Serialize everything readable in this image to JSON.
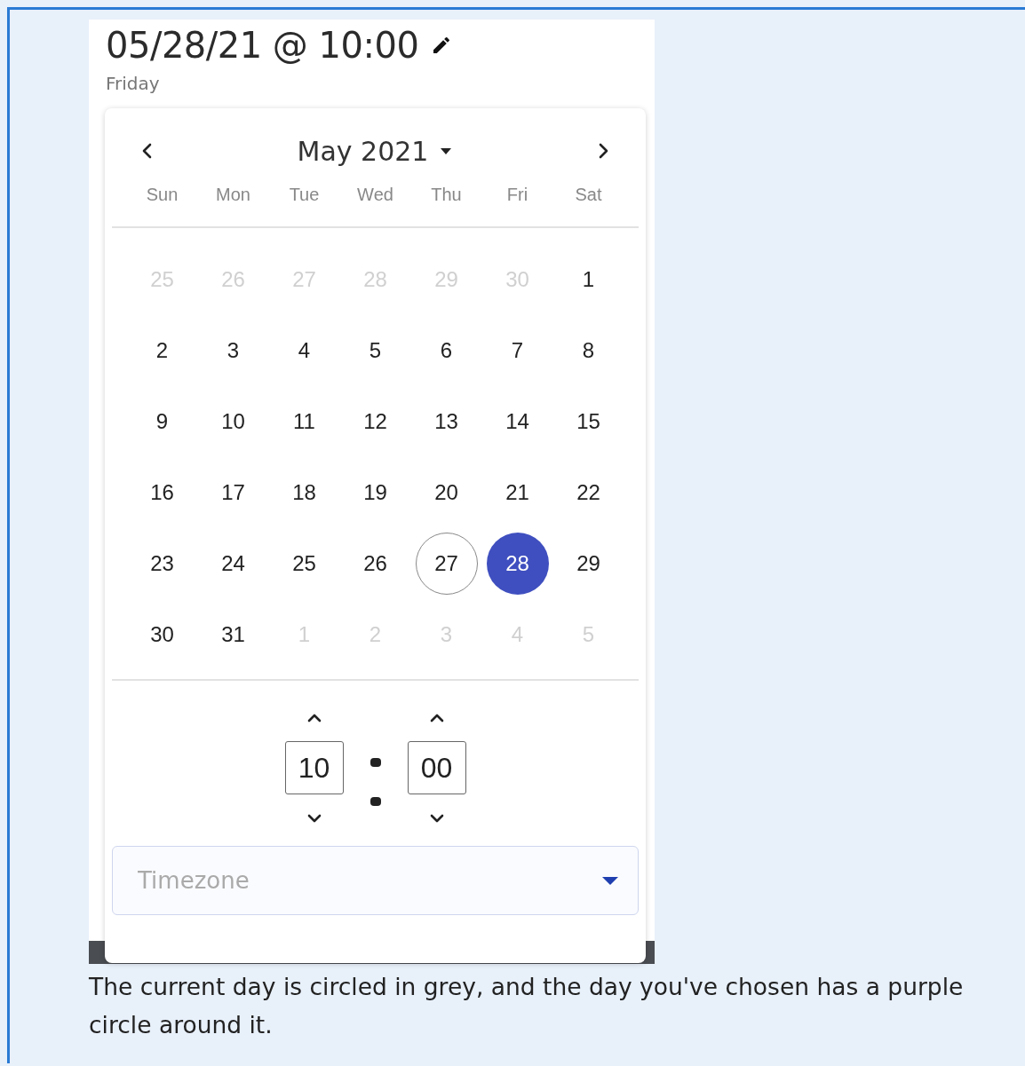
{
  "header": {
    "datetime": "05/28/21 @ 10:00",
    "weekday": "Friday"
  },
  "calendar": {
    "month": "May 2021",
    "weekdays": [
      "Sun",
      "Mon",
      "Tue",
      "Wed",
      "Thu",
      "Fri",
      "Sat"
    ],
    "days": [
      {
        "label": "25",
        "kind": "outside",
        "today": false,
        "selected": false
      },
      {
        "label": "26",
        "kind": "outside",
        "today": false,
        "selected": false
      },
      {
        "label": "27",
        "kind": "outside",
        "today": false,
        "selected": false
      },
      {
        "label": "28",
        "kind": "outside",
        "today": false,
        "selected": false
      },
      {
        "label": "29",
        "kind": "outside",
        "today": false,
        "selected": false
      },
      {
        "label": "30",
        "kind": "outside",
        "today": false,
        "selected": false
      },
      {
        "label": "1",
        "kind": "day",
        "today": false,
        "selected": false
      },
      {
        "label": "2",
        "kind": "day",
        "today": false,
        "selected": false
      },
      {
        "label": "3",
        "kind": "day",
        "today": false,
        "selected": false
      },
      {
        "label": "4",
        "kind": "day",
        "today": false,
        "selected": false
      },
      {
        "label": "5",
        "kind": "day",
        "today": false,
        "selected": false
      },
      {
        "label": "6",
        "kind": "day",
        "today": false,
        "selected": false
      },
      {
        "label": "7",
        "kind": "day",
        "today": false,
        "selected": false
      },
      {
        "label": "8",
        "kind": "day",
        "today": false,
        "selected": false
      },
      {
        "label": "9",
        "kind": "day",
        "today": false,
        "selected": false
      },
      {
        "label": "10",
        "kind": "day",
        "today": false,
        "selected": false
      },
      {
        "label": "11",
        "kind": "day",
        "today": false,
        "selected": false
      },
      {
        "label": "12",
        "kind": "day",
        "today": false,
        "selected": false
      },
      {
        "label": "13",
        "kind": "day",
        "today": false,
        "selected": false
      },
      {
        "label": "14",
        "kind": "day",
        "today": false,
        "selected": false
      },
      {
        "label": "15",
        "kind": "day",
        "today": false,
        "selected": false
      },
      {
        "label": "16",
        "kind": "day",
        "today": false,
        "selected": false
      },
      {
        "label": "17",
        "kind": "day",
        "today": false,
        "selected": false
      },
      {
        "label": "18",
        "kind": "day",
        "today": false,
        "selected": false
      },
      {
        "label": "19",
        "kind": "day",
        "today": false,
        "selected": false
      },
      {
        "label": "20",
        "kind": "day",
        "today": false,
        "selected": false
      },
      {
        "label": "21",
        "kind": "day",
        "today": false,
        "selected": false
      },
      {
        "label": "22",
        "kind": "day",
        "today": false,
        "selected": false
      },
      {
        "label": "23",
        "kind": "day",
        "today": false,
        "selected": false
      },
      {
        "label": "24",
        "kind": "day",
        "today": false,
        "selected": false
      },
      {
        "label": "25",
        "kind": "day",
        "today": false,
        "selected": false
      },
      {
        "label": "26",
        "kind": "day",
        "today": false,
        "selected": false
      },
      {
        "label": "27",
        "kind": "day",
        "today": true,
        "selected": false
      },
      {
        "label": "28",
        "kind": "day",
        "today": false,
        "selected": true
      },
      {
        "label": "29",
        "kind": "day",
        "today": false,
        "selected": false
      },
      {
        "label": "30",
        "kind": "day",
        "today": false,
        "selected": false
      },
      {
        "label": "31",
        "kind": "day",
        "today": false,
        "selected": false
      },
      {
        "label": "1",
        "kind": "outside",
        "today": false,
        "selected": false
      },
      {
        "label": "2",
        "kind": "outside",
        "today": false,
        "selected": false
      },
      {
        "label": "3",
        "kind": "outside",
        "today": false,
        "selected": false
      },
      {
        "label": "4",
        "kind": "outside",
        "today": false,
        "selected": false
      },
      {
        "label": "5",
        "kind": "outside",
        "today": false,
        "selected": false
      }
    ]
  },
  "time": {
    "hours": "10",
    "minutes": "00"
  },
  "timezone": {
    "placeholder": "Timezone"
  },
  "caption": "The current day is circled in grey, and the day you've chosen has a purple circle around it."
}
